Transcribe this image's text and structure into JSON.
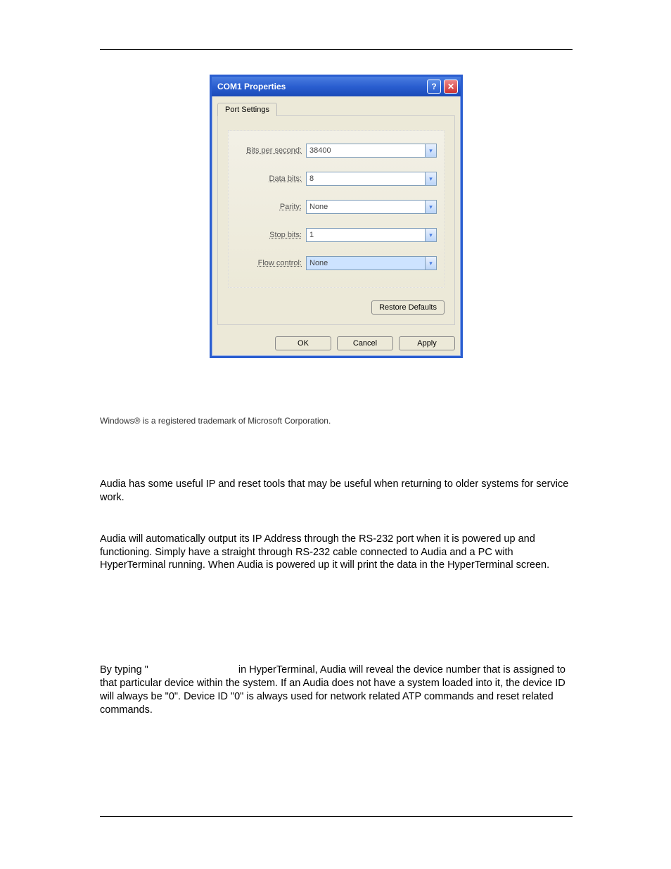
{
  "dialog": {
    "title": "COM1 Properties",
    "tab": "Port Settings",
    "fields": {
      "bits_per_second": {
        "label": "Bits per second:",
        "value": "38400"
      },
      "data_bits": {
        "label": "Data bits:",
        "value": "8"
      },
      "parity": {
        "label": "Parity:",
        "value": "None"
      },
      "stop_bits": {
        "label": "Stop bits:",
        "value": "1"
      },
      "flow_control": {
        "label": "Flow control:",
        "value": "None"
      }
    },
    "restore_defaults": "Restore Defaults",
    "ok": "OK",
    "cancel": "Cancel",
    "apply": "Apply",
    "help_glyph": "?",
    "close_glyph": "✕"
  },
  "trademark": "Windows® is a registered trademark of Microsoft Corporation.",
  "paragraphs": {
    "p1": "Audia has some useful IP and reset tools that may be useful when returning to older systems for service work.",
    "p2": "Audia will automatically output its IP Address through the RS-232 port when it is powered up and functioning. Simply have a straight through RS-232 cable connected to Audia and a PC with HyperTerminal running. When Audia is powered up it will print the data in the HyperTerminal screen.",
    "p3_a": "By typing \"",
    "p3_b": "in HyperTerminal, Audia will reveal the device number that is assigned to that particular device within the system. If an Audia does not have a system loaded into it, the device ID will always be \"0\". Device ID \"0\" is always used for network related ATP commands and reset related commands."
  }
}
